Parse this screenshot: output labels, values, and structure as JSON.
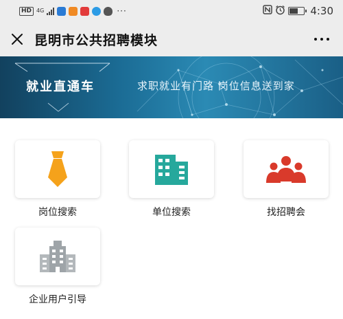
{
  "status_bar": {
    "hd": "HD",
    "network_top": "4G",
    "network_bottom": "⁴⁶",
    "time": "4:30",
    "battery_level": 0.6,
    "more_notifications": "···"
  },
  "titlebar": {
    "title": "昆明市公共招聘模块"
  },
  "banner": {
    "title": "就业直通车",
    "slogan": "求职就业有门路  岗位信息送到家"
  },
  "menu": {
    "items": [
      {
        "label": "岗位搜索",
        "icon": "necktie-icon",
        "color": "#f5a21b"
      },
      {
        "label": "单位搜索",
        "icon": "office-building-icon",
        "color": "#26a89c"
      },
      {
        "label": "找招聘会",
        "icon": "people-group-icon",
        "color": "#d93a2b"
      },
      {
        "label": "企业用户引导",
        "icon": "enterprise-building-icon",
        "color": "#9ea4a8"
      }
    ]
  }
}
